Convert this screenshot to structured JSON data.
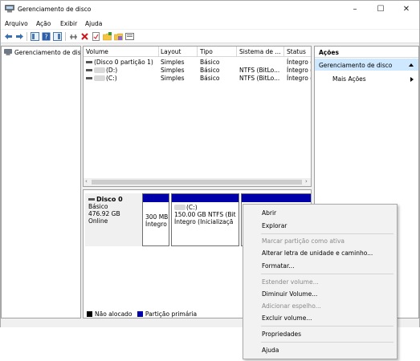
{
  "window": {
    "title": "Gerenciamento de disco",
    "minimize": "–",
    "maximize": "☐",
    "close": "✕"
  },
  "menu": [
    "Arquivo",
    "Ação",
    "Exibir",
    "Ajuda"
  ],
  "toolbar_icons": [
    "back-arrow-icon",
    "forward-arrow-icon",
    "console-tree-icon",
    "help-icon",
    "pane-icon",
    "connect-icon",
    "delete-icon",
    "properties-icon",
    "new-folder-icon",
    "export-icon",
    "view-icon"
  ],
  "tree": {
    "root_label": "Gerenciamento de disco"
  },
  "volume_list": {
    "columns": [
      "Volume",
      "Layout",
      "Tipo",
      "Sistema de ...",
      "Status"
    ],
    "rows": [
      {
        "volume": "(Disco 0 partição 1)",
        "layout": "Simples",
        "tipo": "Básico",
        "sistema": "",
        "status": "Íntegro ("
      },
      {
        "volume": "(D:)",
        "layout": "Simples",
        "tipo": "Básico",
        "sistema": "NTFS (BitLo...",
        "status": "Íntegro ("
      },
      {
        "volume": "(C:)",
        "layout": "Simples",
        "tipo": "Básico",
        "sistema": "NTFS (BitLo...",
        "status": "Íntegro ("
      }
    ]
  },
  "disk": {
    "name": "Disco 0",
    "type": "Básico",
    "size": "476.92 GB",
    "state": "Online",
    "partitions": [
      {
        "line1": "300 MB",
        "line2": "Íntegro"
      },
      {
        "label": "(C:)",
        "line1": "150.00 GB NTFS (Bit",
        "line2": "Íntegro (Inicializaçã"
      }
    ]
  },
  "legend": {
    "unallocated": "Não alocado",
    "primary": "Partição primária"
  },
  "actions": {
    "header": "Ações",
    "selected": "Gerenciamento de disco",
    "more": "Mais Ações"
  },
  "context_menu": {
    "items": [
      {
        "label": "Abrir",
        "enabled": true
      },
      {
        "label": "Explorar",
        "enabled": true
      },
      {
        "label": "Marcar partição como ativa",
        "enabled": false
      },
      {
        "label": "Alterar letra de unidade e caminho...",
        "enabled": true
      },
      {
        "label": "Formatar...",
        "enabled": true
      },
      {
        "label": "Estender volume...",
        "enabled": false
      },
      {
        "label": "Diminuir Volume...",
        "enabled": true
      },
      {
        "label": "Adicionar espelho...",
        "enabled": false
      },
      {
        "label": "Excluir volume...",
        "enabled": true
      },
      {
        "label": "Propriedades",
        "enabled": true
      },
      {
        "label": "Ajuda",
        "enabled": true
      }
    ]
  },
  "colors": {
    "primary_partition": "#0000ab",
    "unallocated": "#000000",
    "selection": "#cde8ff"
  }
}
